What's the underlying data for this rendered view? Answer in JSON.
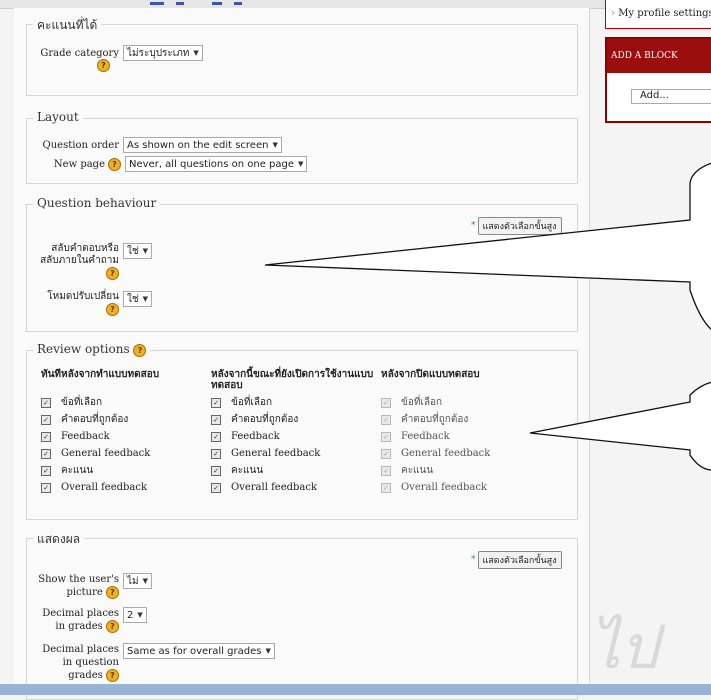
{
  "sidebar": {
    "profile_link": "My profile settings",
    "add_block": {
      "title": "ADD A BLOCK",
      "select_value": "Add..."
    }
  },
  "grade": {
    "legend": "คะแนนที่ได้",
    "category_label": "Grade category",
    "category_value": "ไม่ระบุประเภท"
  },
  "layout": {
    "legend": "Layout",
    "order_label": "Question order",
    "order_value": "As shown on the edit screen",
    "newpage_label": "New page",
    "newpage_value": "Never, all questions on one page"
  },
  "behaviour": {
    "legend": "Question behaviour",
    "advanced_button": "แสดงตัวเลือกขั้นสูง",
    "shuffle_label_1": "สลับคำตอบหรือ",
    "shuffle_label_2": "สลับภายในคำถาม",
    "shuffle_value": "ใช่",
    "adaptive_label": "โหมดปรับเปลี่ยน",
    "adaptive_value": "ใช่"
  },
  "review": {
    "legend": "Review options",
    "columns": [
      {
        "heading": "ทันทีหลังจากทำแบบทดสอบ",
        "disabled": false,
        "items": [
          "ข้อที่เลือก",
          "คำตอบที่ถูกต้อง",
          "Feedback",
          "General feedback",
          "คะแนน",
          "Overall feedback"
        ]
      },
      {
        "heading": "หลังจากนี้ขณะที่ยังเปิดการใช้งานแบบทดสอบ",
        "disabled": false,
        "items": [
          "ข้อที่เลือก",
          "คำตอบที่ถูกต้อง",
          "Feedback",
          "General feedback",
          "คะแนน",
          "Overall feedback"
        ]
      },
      {
        "heading": "หลังจากปิดแบบทดสอบ",
        "disabled": true,
        "items": [
          "ข้อที่เลือก",
          "คำตอบที่ถูกต้อง",
          "Feedback",
          "General feedback",
          "คะแนน",
          "Overall feedback"
        ]
      }
    ]
  },
  "display": {
    "legend": "แสดงผล",
    "advanced_button": "แสดงตัวเลือกขั้นสูง",
    "picture_label_1": "Show the user's",
    "picture_label_2": "picture",
    "picture_value": "ไม่",
    "decimals_label_1": "Decimal places",
    "decimals_label_2": "in grades",
    "decimals_value": "2",
    "qdecimals_label_1": "Decimal places",
    "qdecimals_label_2": "in question",
    "qdecimals_label_3": "grades",
    "qdecimals_value": "Same as for overall grades"
  },
  "watermark": "ไป",
  "colors": {
    "accent": "#9b0e0e",
    "help": "#f0b020",
    "link": "#3a56b0"
  },
  "icons": [
    "help-icon",
    "checkbox-icon",
    "dropdown-arrow-icon"
  ]
}
